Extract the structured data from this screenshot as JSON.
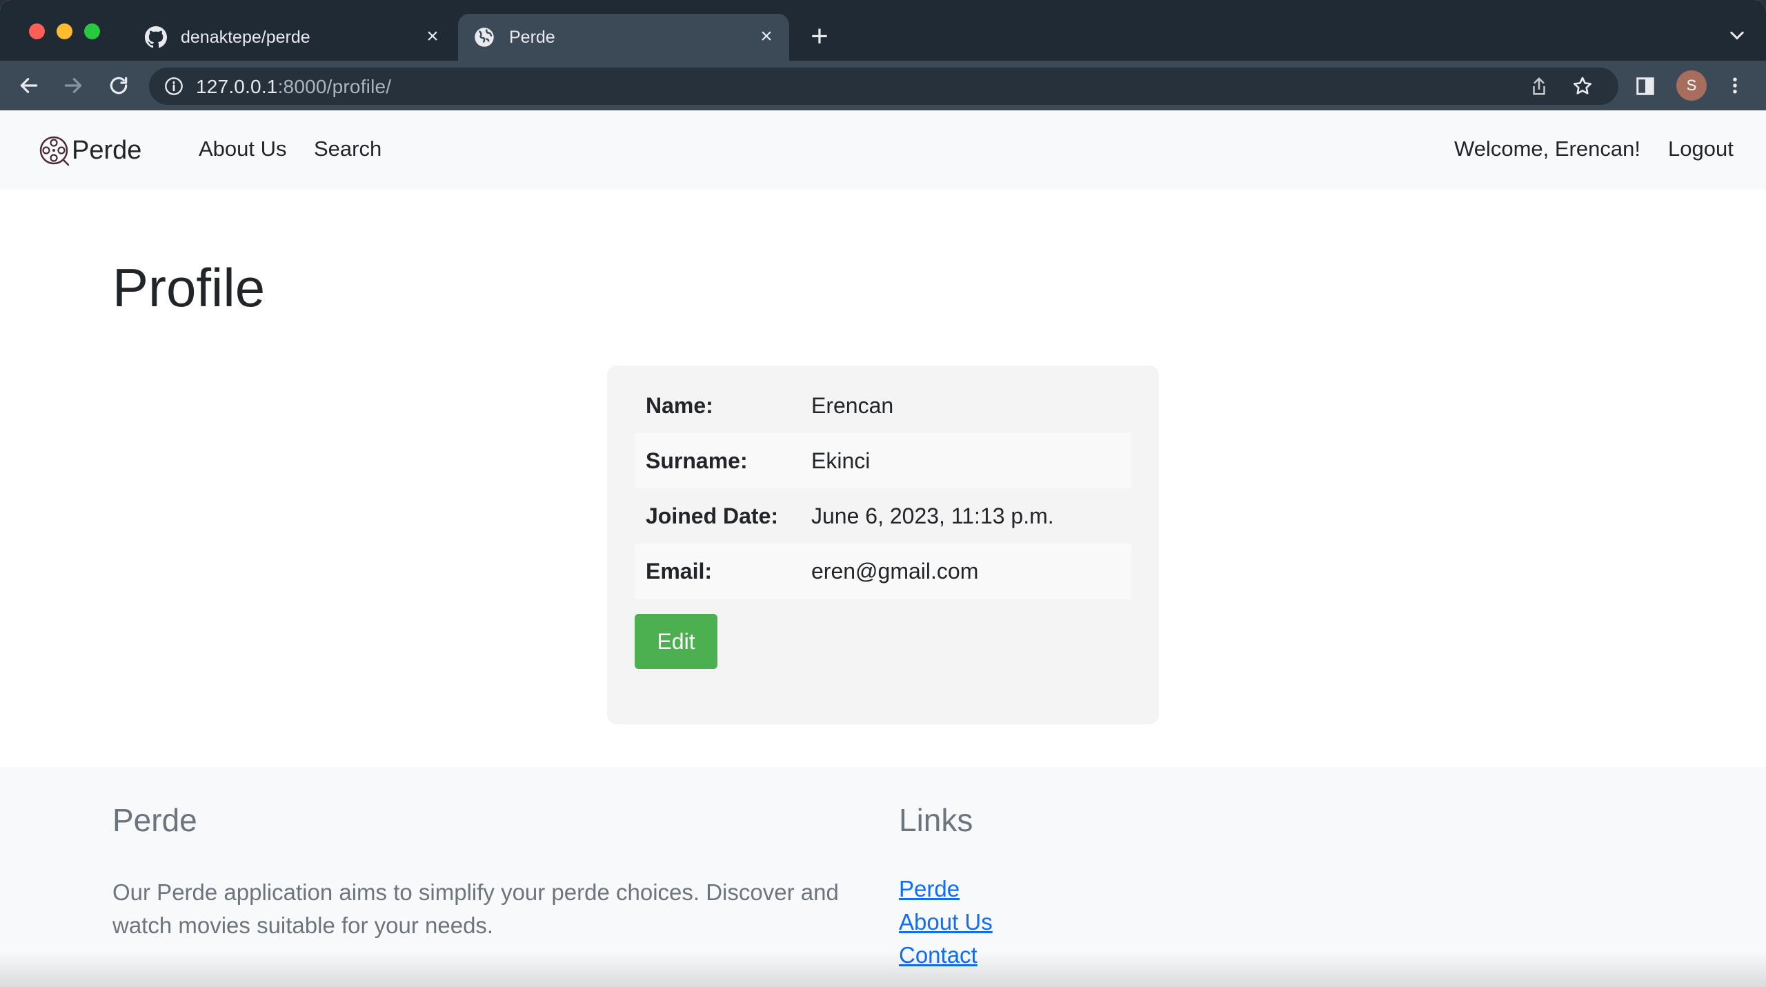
{
  "browser": {
    "tabs": [
      {
        "title": "denaktepe/perde",
        "icon": "github-icon"
      },
      {
        "title": "Perde",
        "icon": "globe-icon"
      }
    ],
    "new_tab_label": "+",
    "url_host": "127.0.0.1",
    "url_rest": ":8000/profile/",
    "profile_initial": "S",
    "colors": {
      "tab_bg": "#202a34",
      "toolbar_bg": "#3c4a58",
      "omnibox_bg": "#26313c",
      "avatar": "#a76e5e"
    }
  },
  "navbar": {
    "brand": "Perde",
    "links": [
      "About Us",
      "Search"
    ],
    "welcome": "Welcome, Erencan!",
    "logout": "Logout"
  },
  "main": {
    "title": "Profile",
    "fields": [
      {
        "label": "Name:",
        "value": "Erencan"
      },
      {
        "label": "Surname:",
        "value": "Ekinci"
      },
      {
        "label": "Joined Date:",
        "value": "June 6, 2023, 11:13 p.m."
      },
      {
        "label": "Email:",
        "value": "eren@gmail.com"
      }
    ],
    "edit_label": "Edit",
    "colors": {
      "edit_button": "#4caf50"
    }
  },
  "footer": {
    "title": "Perde",
    "description": "Our Perde application aims to simplify your perde choices. Discover and watch movies suitable for your needs.",
    "links_title": "Links",
    "links": [
      "Perde",
      "About Us",
      "Contact"
    ],
    "colors": {
      "link": "#0d6efd"
    }
  }
}
